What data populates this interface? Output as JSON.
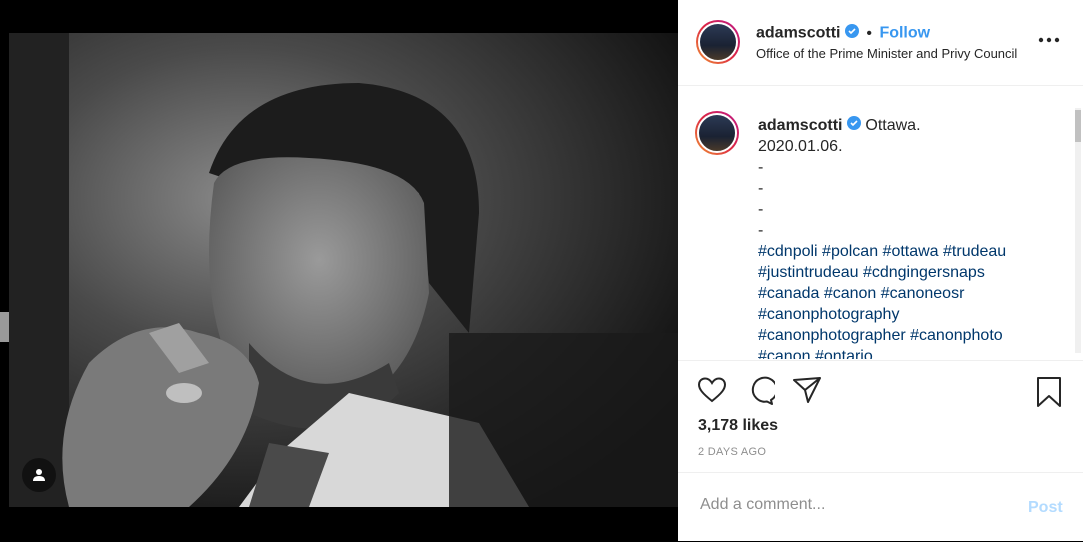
{
  "header": {
    "username": "adamscotti",
    "separator": "•",
    "follow_label": "Follow",
    "location": "Office of the Prime Minister and Privy Council"
  },
  "caption": {
    "username": "adamscotti",
    "location": "Ottawa.",
    "date": "2020.01.06.",
    "dashes": [
      "-",
      "-",
      "-",
      "-"
    ],
    "hashtag_lines": [
      "#cdnpoli #polcan #ottawa #trudeau",
      "#justintrudeau #cdngingersnaps",
      "#canada #canon #canoneosr",
      "#canonphotography",
      "#canonphotographer #canonphoto",
      "#canon #ontario"
    ]
  },
  "actions": {
    "likes": "3,178 likes",
    "time": "2 DAYS AGO"
  },
  "comment": {
    "placeholder": "Add a comment...",
    "post_label": "Post"
  },
  "colors": {
    "link": "#3897f0",
    "hashtag": "#00376b",
    "verified": "#3897f0"
  },
  "icons": [
    "user-tag-icon",
    "verified-icon",
    "more-options-icon",
    "heart-icon",
    "comment-icon",
    "share-icon",
    "bookmark-icon"
  ]
}
